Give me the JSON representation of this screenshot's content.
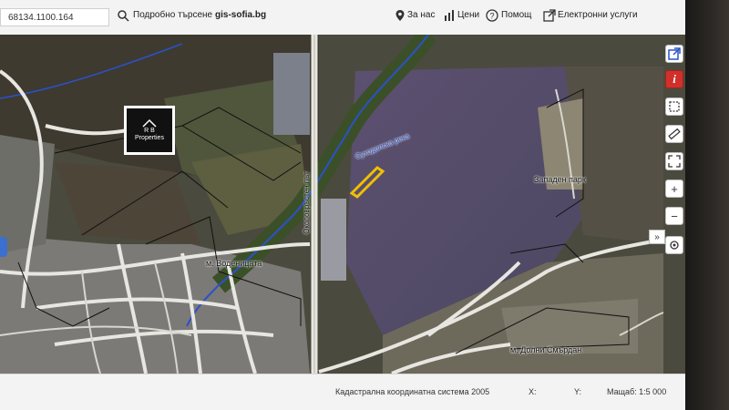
{
  "header": {
    "search_value": "68134.1100.164",
    "advanced_search": "Подробно търсене",
    "site_name": "gis-sofia.bg",
    "about": "За нас",
    "prices": "Цени",
    "help": "Помощ",
    "e_services": "Електронни услуги"
  },
  "map": {
    "labels": {
      "zapaden_park": "Западен парк",
      "vodenitsata": "м. Воденицата",
      "dolni_smardan": "м. Долни Смърдан",
      "suhodolska_reka": "Суходолска река",
      "road_vertical": "Околовръстен път"
    },
    "logo": {
      "line1": "R B",
      "line2": "Properties"
    }
  },
  "toolbar": {
    "expand": "»",
    "zoom_in": "+",
    "zoom_out": "−"
  },
  "footer": {
    "coord_system": "Кадастрална координатна система 2005",
    "x_label": "X:",
    "y_label": "Y:",
    "scale_label": "Мащаб: 1:5 000"
  },
  "colors": {
    "info_red": "#d0302a",
    "parcel_highlight": "#f0c000",
    "river_blue": "#2a52c8"
  }
}
